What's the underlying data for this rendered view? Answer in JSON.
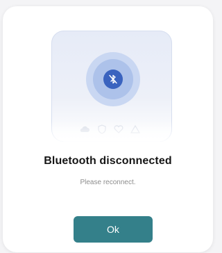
{
  "dialog": {
    "title": "Bluetooth disconnected",
    "message": "Please reconnect.",
    "ok_label": "Ok"
  },
  "icons": {
    "status": "bluetooth-disabled-icon",
    "background": [
      "cloud-icon",
      "shield-icon",
      "heart-icon",
      "triangle-icon"
    ]
  },
  "colors": {
    "accent": "#34808a",
    "bluetooth_badge": "#3a63bf",
    "halo_outer": "#c9d7f2",
    "halo_inner": "#adc2ea",
    "title_text": "#161616",
    "message_text": "#8c8c8c"
  }
}
